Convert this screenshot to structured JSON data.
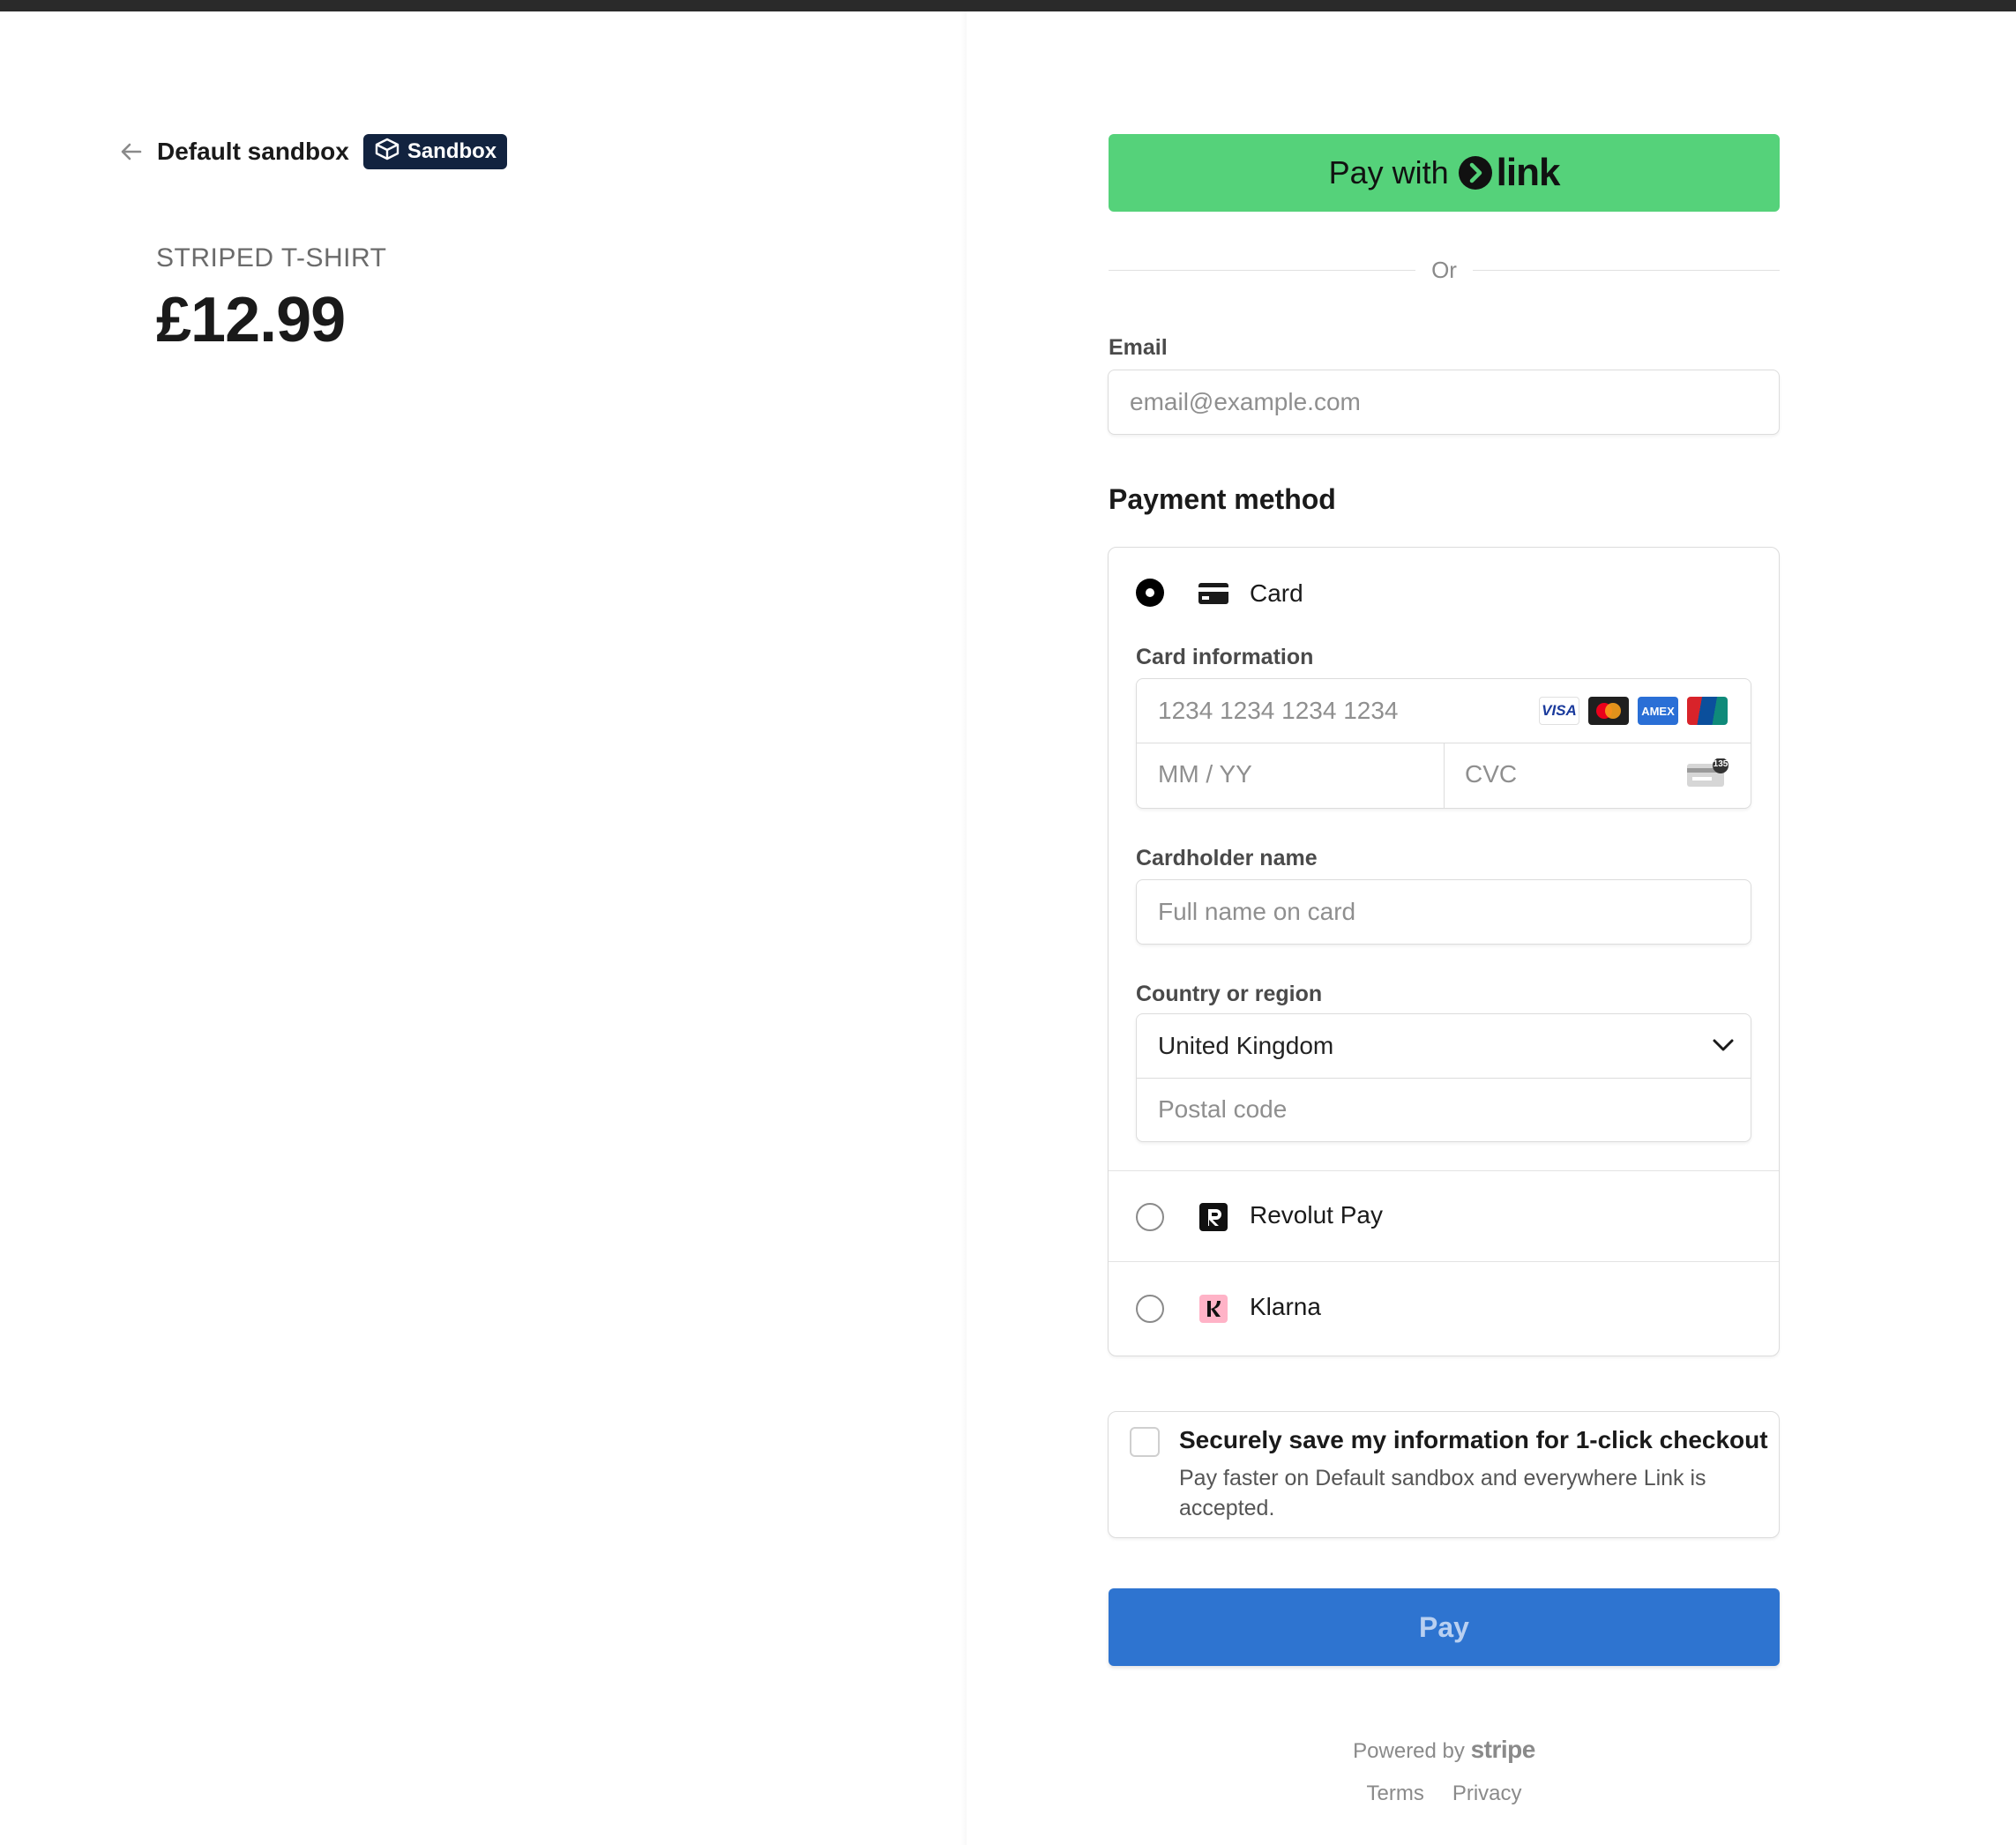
{
  "merchant": {
    "name": "Default sandbox",
    "badge_label": "Sandbox"
  },
  "product": {
    "name": "STRIPED T-SHIRT",
    "price": "£12.99"
  },
  "link_button": {
    "prefix": "Pay with",
    "brand": "link",
    "color": "#55d27a"
  },
  "divider_text": "Or",
  "email": {
    "label": "Email",
    "placeholder": "email@example.com",
    "value": ""
  },
  "payment_method": {
    "title": "Payment method",
    "options": [
      {
        "label": "Card",
        "selected": true,
        "icon": "card-icon"
      },
      {
        "label": "Revolut Pay",
        "selected": false,
        "icon": "revolut-icon"
      },
      {
        "label": "Klarna",
        "selected": false,
        "icon": "klarna-icon"
      }
    ],
    "card": {
      "info_label": "Card information",
      "number_placeholder": "1234 1234 1234 1234",
      "expiry_placeholder": "MM / YY",
      "cvc_placeholder": "CVC",
      "brands": [
        "VISA",
        "Mastercard",
        "AMEX",
        "UnionPay"
      ],
      "cvc_icon_text": "135",
      "cardholder_label": "Cardholder name",
      "cardholder_placeholder": "Full name on card",
      "country_label": "Country or region",
      "country_value": "United Kingdom",
      "postal_placeholder": "Postal code"
    }
  },
  "save_info": {
    "title": "Securely save my information for 1-click checkout",
    "description": "Pay faster on Default sandbox and everywhere Link is accepted.",
    "checked": false
  },
  "pay_button": {
    "label": "Pay",
    "color": "#2e74d0"
  },
  "footer": {
    "powered_prefix": "Powered by",
    "powered_brand": "stripe",
    "links": [
      "Terms",
      "Privacy"
    ]
  }
}
